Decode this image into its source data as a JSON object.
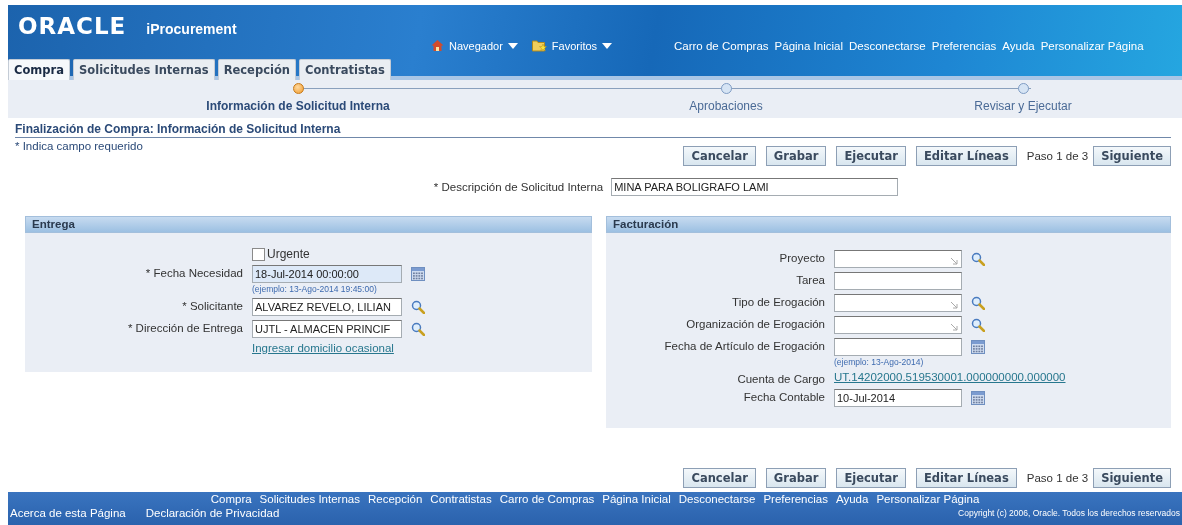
{
  "header": {
    "logo": "ORACLE",
    "app_name": "iProcurement",
    "menus": [
      {
        "kind": "home",
        "label": "Navegador"
      },
      {
        "kind": "favorites",
        "label": "Favoritos"
      }
    ],
    "global_links": [
      "Carro de Compras",
      "Página Inicial",
      "Desconectarse",
      "Preferencias",
      "Ayuda",
      "Personalizar Página"
    ]
  },
  "tabs": [
    {
      "label": "Compra",
      "selected": true
    },
    {
      "label": "Solicitudes Internas",
      "selected": false
    },
    {
      "label": "Recepción",
      "selected": false
    },
    {
      "label": "Contratistas",
      "selected": false
    }
  ],
  "train": [
    {
      "label": "Información de Solicitud Interna",
      "selected": true
    },
    {
      "label": "Aprobaciones",
      "selected": false
    },
    {
      "label": "Revisar y Ejecutar",
      "selected": false
    }
  ],
  "page_title": "Finalización de Compra: Información de Solicitud Interna",
  "required_note": "* Indica campo requerido",
  "top_buttons": [
    "Cancelar",
    "Grabar",
    "Ejecutar",
    "Editar Líneas"
  ],
  "top_step": "Paso 1 de 3",
  "top_next": "Siguiente",
  "description": {
    "label": "* Descripción de Solicitud Interna",
    "value": "MINA PARA BOLIGRAFO LAMI"
  },
  "entrega": {
    "title": "Entrega",
    "urgent": {
      "label": "Urgente",
      "checked": false
    },
    "fields": [
      {
        "kind": "date",
        "label": "* Fecha Necesidad",
        "value": "18-Jul-2014 00:00:00",
        "hint": "(ejemplo: 13-Ago-2014 19:45:00)"
      },
      {
        "kind": "lov",
        "label": "* Solicitante",
        "value": "ALVAREZ REVELO, LILIAN"
      },
      {
        "kind": "lov",
        "label": "* Dirección de Entrega",
        "value": "UJTL - ALMACEN PRINCIF"
      }
    ],
    "link": "Ingresar domicilio ocasional"
  },
  "facturacion": {
    "title": "Facturación",
    "fields": [
      {
        "kind": "choice",
        "label": "Proyecto"
      },
      {
        "kind": "text",
        "label": "Tarea"
      },
      {
        "kind": "choice",
        "label": "Tipo de Erogación"
      },
      {
        "kind": "choice",
        "label": "Organización de Erogación"
      },
      {
        "kind": "date",
        "label": "Fecha de Artículo de Erogación",
        "hint": "(ejemplo: 13-Ago-2014)"
      },
      {
        "kind": "link",
        "label": "Cuenta de Cargo",
        "value": "UT.14202000.519530001.000000000.000000"
      },
      {
        "kind": "date",
        "label": "Fecha Contable",
        "value": "10-Jul-2014"
      }
    ]
  },
  "bottom_buttons": [
    "Cancelar",
    "Grabar",
    "Ejecutar",
    "Editar Líneas"
  ],
  "bottom_step": "Paso 1 de 3",
  "bottom_next": "Siguiente",
  "footer": {
    "links": [
      "Compra",
      "Solicitudes Internas",
      "Recepción",
      "Contratistas",
      "Carro de Compras",
      "Página Inicial",
      "Desconectarse",
      "Preferencias",
      "Ayuda",
      "Personalizar Página"
    ],
    "bottom_links": [
      "Acerca de esta Página",
      "Declaración de Privacidad"
    ],
    "copyright": "Copyright (c) 2006, Oracle. Todos los derechos reservados"
  }
}
